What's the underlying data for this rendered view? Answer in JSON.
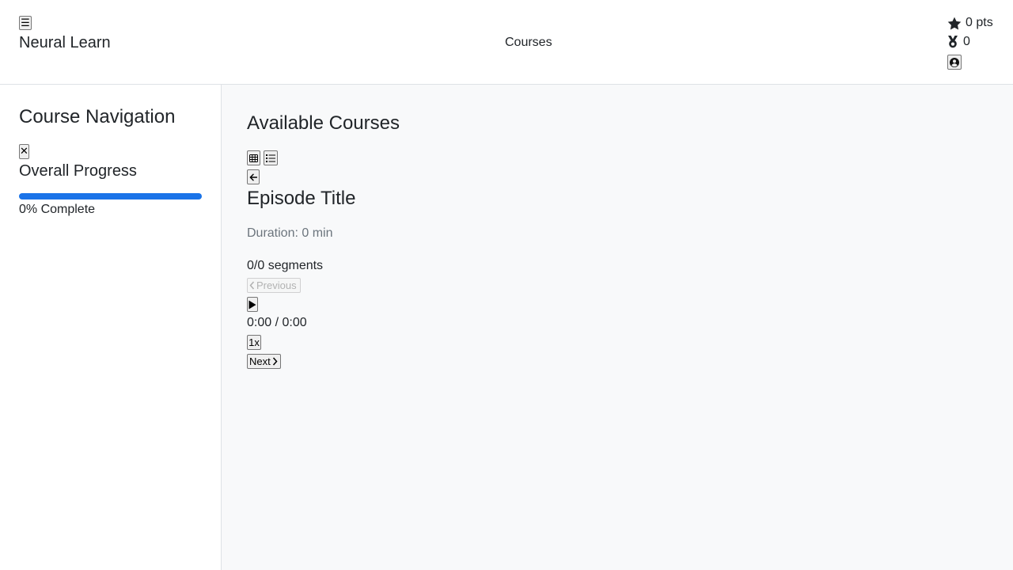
{
  "header": {
    "menu_icon": "hamburger-menu-icon",
    "menu_glyph": "☰",
    "brand": "Neural Learn",
    "nav_link": "Courses",
    "points": "0 pts",
    "points_icon": "star-icon",
    "badges": "0",
    "badges_icon": "medal-icon",
    "profile_icon": "user-circle-icon"
  },
  "sidebar": {
    "title": "Course Navigation",
    "close_glyph": "✕",
    "close_icon": "close-icon",
    "progress_title": "Overall Progress",
    "progress_percent": 0,
    "progress_label": "0% Complete"
  },
  "main": {
    "title": "Available Courses",
    "view_toggle": {
      "grid_icon": "grid-view-icon",
      "list_icon": "list-view-icon"
    },
    "back_icon": "arrow-left-icon",
    "episode": {
      "title": "Episode Title",
      "duration": "Duration: 0 min",
      "segments": "0/0 segments"
    },
    "player": {
      "previous_label": "Previous",
      "previous_disabled": true,
      "play_icon": "play-icon",
      "time": "0:00 / 0:00",
      "speed": "1x",
      "next_label": "Next"
    }
  },
  "colors": {
    "accent": "#1a73e8",
    "muted_text": "#6c757d",
    "main_background": "#f8f9fa",
    "text": "#212529"
  }
}
